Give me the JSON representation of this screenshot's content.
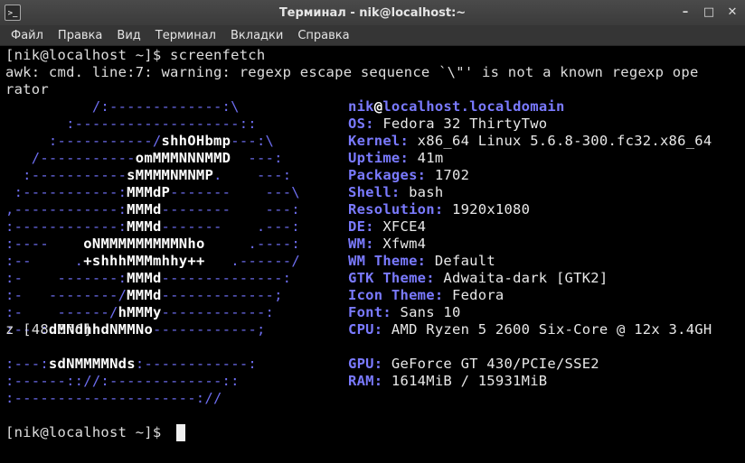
{
  "window": {
    "title": "Терминал - nik@localhost:~",
    "icon_label": ">_",
    "buttons": [
      "–",
      "□",
      "✕"
    ]
  },
  "menu": [
    "Файл",
    "Правка",
    "Вид",
    "Терминал",
    "Вкладки",
    "Справка"
  ],
  "terminal": {
    "prompt_line": "[nik@localhost ~]$ screenfetch",
    "warning_1": "awk: cmd. line:7: warning: regexp escape sequence `\\\"' is not a known regexp ope",
    "warning_2": "rator",
    "logo": [
      "          /:-------------:\\         ",
      "       :-------------------::       ",
      "     :-----------/shhOHbmp---:\\     ",
      "   /-----------omMMMNNNMMD  ---:    ",
      "  :-----------sMMMMNMNMP.    ---:   ",
      " :-----------:MMMdP-------    ---\\  ",
      ",------------:MMMd--------    ---:  ",
      ":------------:MMMd-------    .---:  ",
      ":----    oNMMMMMMMMMNho     .----:  ",
      ":--     .+shhhMMMmhhy++   .------/  ",
      ":-    -------:MMMd--------------:   ",
      ":-   --------/MMMd-------------;    ",
      ":-    ------/hMMMy------------:     ",
      ":-- :dMNdhhdNMMNo------------;      ",
      ":---:sdNMMMMNds:------------:       ",
      ":------:://:-------------::         ",
      ":---------------------://           "
    ],
    "user": "nik",
    "at": "@",
    "host": "localhost.localdomain",
    "info": [
      {
        "key": "OS:",
        "value": "Fedora 32 ThirtyTwo"
      },
      {
        "key": "Kernel:",
        "value": "x86_64 Linux 5.6.8-300.fc32.x86_64"
      },
      {
        "key": "Uptime:",
        "value": "41m"
      },
      {
        "key": "Packages:",
        "value": "1702"
      },
      {
        "key": "Shell:",
        "value": "bash"
      },
      {
        "key": "Resolution:",
        "value": "1920x1080"
      },
      {
        "key": "DE:",
        "value": "XFCE4"
      },
      {
        "key": "WM:",
        "value": "Xfwm4"
      },
      {
        "key": "WM Theme:",
        "value": "Default"
      },
      {
        "key": "GTK Theme:",
        "value": "Adwaita-dark [GTK2]"
      },
      {
        "key": "Icon Theme:",
        "value": "Fedora"
      },
      {
        "key": "Font:",
        "value": "Sans 10"
      },
      {
        "key": "CPU:",
        "value": "AMD Ryzen 5 2600 Six-Core @ 12x 3.4GH"
      },
      {
        "key": "GPU:",
        "value": "GeForce GT 430/PCIe/SSE2"
      },
      {
        "key": "RAM:",
        "value": "1614MiB / 15931MiB"
      }
    ],
    "cpu_wrap": "z [48.6°C]",
    "final_prompt": "[nik@localhost ~]$ "
  }
}
